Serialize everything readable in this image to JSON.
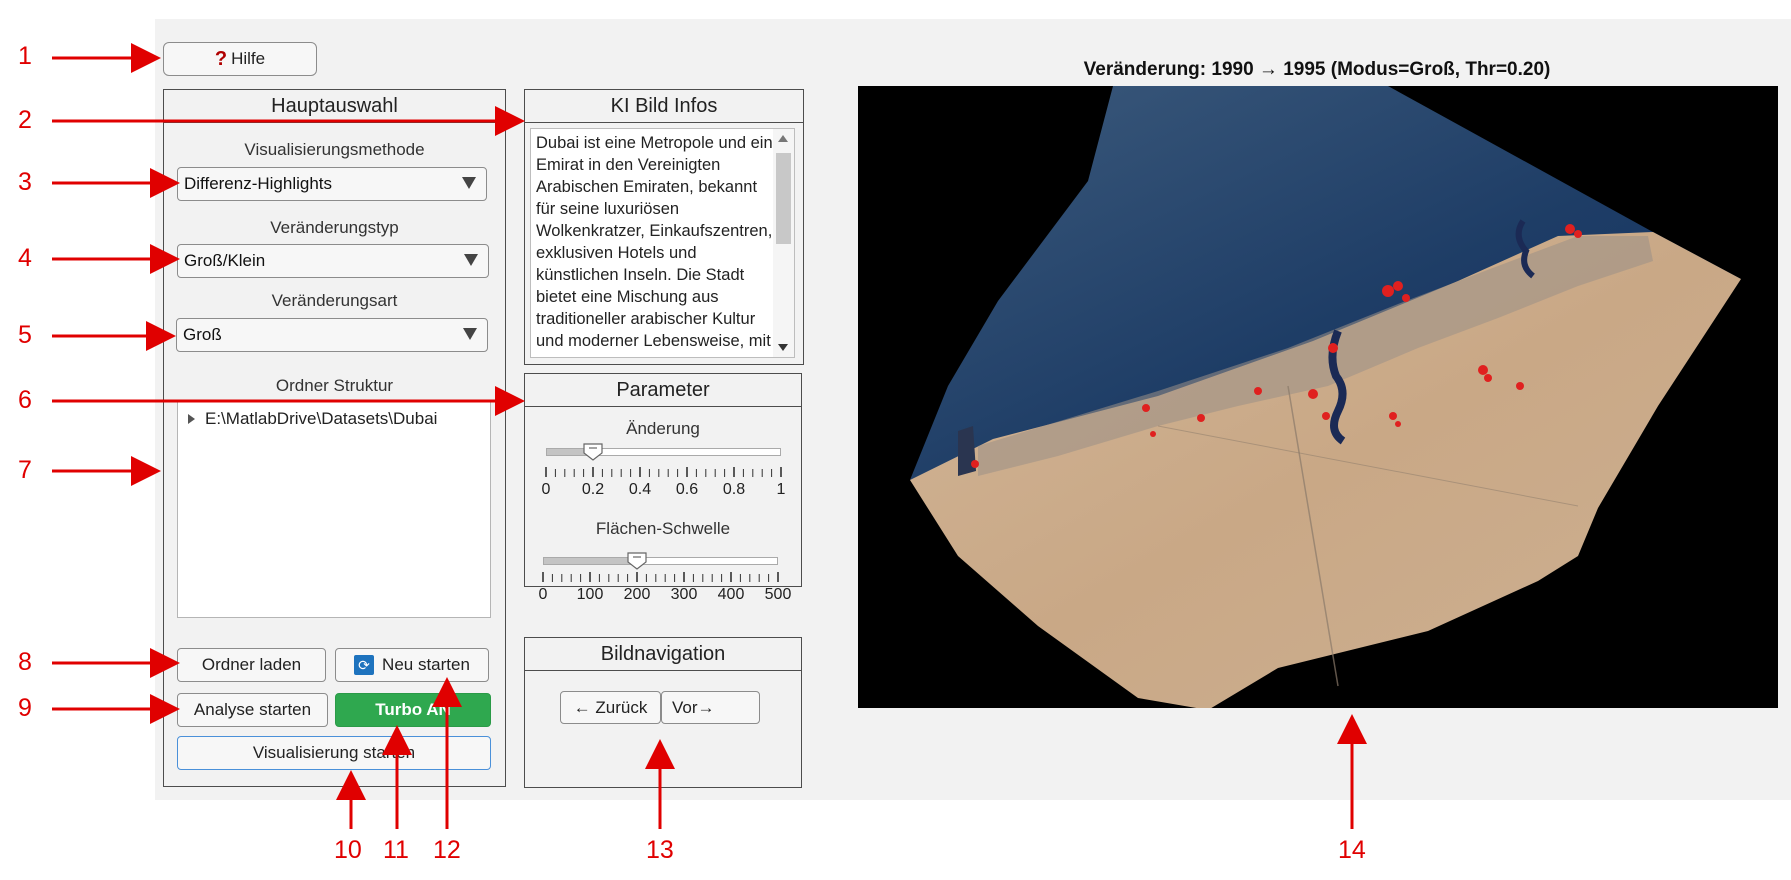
{
  "help": {
    "label": "Hilfe",
    "icon": "question-icon"
  },
  "main_panel": {
    "title": "Hauptauswahl",
    "viz_method": {
      "label": "Visualisierungsmethode",
      "value": "Differenz-Highlights"
    },
    "change_type": {
      "label": "Veränderungstyp",
      "value": "Groß/Klein"
    },
    "change_kind": {
      "label": "Veränderungsart",
      "value": "Groß"
    },
    "folder": {
      "label": "Ordner Struktur",
      "path": "E:\\MatlabDrive\\Datasets\\Dubai"
    },
    "buttons": {
      "load_folder": "Ordner laden",
      "restart": "Neu starten",
      "start_analysis": "Analyse starten",
      "turbo": "Turbo AN",
      "start_viz": "Visualisierung starten"
    }
  },
  "ai_panel": {
    "title": "KI Bild Infos",
    "text": "Dubai ist eine Metropole und ein Emirat in den Vereinigten Arabischen Emiraten, bekannt für seine luxuriösen Wolkenkratzer, Einkaufszentren, exklusiven Hotels und künstlichen Inseln. Die Stadt bietet eine Mischung aus traditioneller arabischer Kultur und moderner Lebensweise, mit"
  },
  "params_panel": {
    "title": "Parameter",
    "change": {
      "label": "Änderung",
      "value": 0.2,
      "min": 0,
      "max": 1,
      "ticks": [
        "0",
        "0.2",
        "0.4",
        "0.6",
        "0.8",
        "1"
      ]
    },
    "area": {
      "label": "Flächen-Schwelle",
      "value": 200,
      "min": 0,
      "max": 500,
      "ticks": [
        "0",
        "100",
        "200",
        "300",
        "400",
        "500"
      ]
    }
  },
  "nav_panel": {
    "title": "Bildnavigation",
    "back": "← Zurück",
    "forward": "Vor→"
  },
  "image": {
    "title": "Veränderung: 1990 → 1995 (Modus=Groß, Thr=0.20)"
  },
  "annotations": [
    "1",
    "2",
    "3",
    "4",
    "5",
    "6",
    "7",
    "8",
    "9",
    "10",
    "11",
    "12",
    "13",
    "14"
  ],
  "colors": {
    "annotation": "#e00000",
    "turbo_green": "#2fa84f",
    "highlight": "#e0201f"
  }
}
